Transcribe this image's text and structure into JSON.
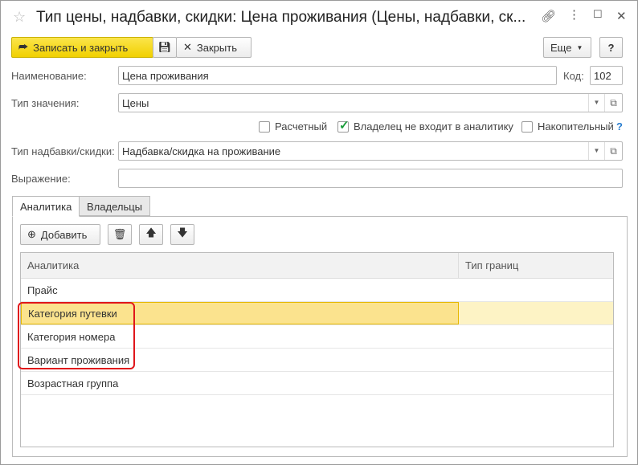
{
  "window": {
    "title": "Тип цены, надбавки, скидки: Цена проживания (Цены, надбавки, ск..."
  },
  "toolbar": {
    "save_close": "Записать и закрыть",
    "close": "Закрыть",
    "more": "Еще",
    "help": "?"
  },
  "form": {
    "name_label": "Наименование:",
    "name_value": "Цена проживания",
    "code_label": "Код:",
    "code_value": "102",
    "value_type_label": "Тип значения:",
    "value_type_value": "Цены",
    "calc_label": "Расчетный",
    "owner_label": "Владелец не входит в аналитику",
    "cumulative_label": "Накопительный",
    "help_mark": "?",
    "markup_type_label": "Тип надбавки/скидки:",
    "markup_type_value": "Надбавка/скидка на проживание",
    "expression_label": "Выражение:",
    "expression_value": ""
  },
  "checkboxes": {
    "calc": false,
    "owner": true,
    "cumulative": false
  },
  "tabs": [
    "Аналитика",
    "Владельцы"
  ],
  "tab_toolbar": {
    "add": "Добавить"
  },
  "grid": {
    "columns": [
      "Аналитика",
      "Тип границ"
    ],
    "rows": [
      "Прайс",
      "Категория путевки",
      "Категория номера",
      "Вариант проживания",
      "Возрастная группа"
    ],
    "selected": 1
  }
}
